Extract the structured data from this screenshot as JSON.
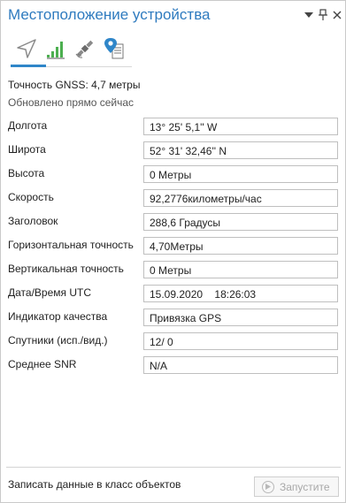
{
  "window": {
    "title": "Местоположение устройства",
    "menu_icon": "dropdown-arrow-icon",
    "pin_icon": "pin-icon",
    "close_icon": "close-icon"
  },
  "tabs": [
    {
      "name": "navigation-icon",
      "active": true
    },
    {
      "name": "signal-strength-icon",
      "active": false
    },
    {
      "name": "satellite-icon",
      "active": false
    },
    {
      "name": "location-list-icon",
      "active": false
    }
  ],
  "status": {
    "accuracy": "Точность GNSS: 4,7 метры",
    "updated": "Обновлено прямо сейчас"
  },
  "fields": [
    {
      "label": "Долгота",
      "value": "13° 25' 5,1'' W"
    },
    {
      "label": "Широта",
      "value": "52° 31' 32,46'' N"
    },
    {
      "label": "Высота",
      "value": "0 Метры"
    },
    {
      "label": "Скорость",
      "value": "92,2776километры/час"
    },
    {
      "label": "Заголовок",
      "value": "288,6 Градусы"
    },
    {
      "label": "Горизонтальная точность",
      "value": "4,70Метры"
    },
    {
      "label": "Вертикальная точность",
      "value": "0 Метры"
    },
    {
      "label": "Дата/Время UTC",
      "value": "15.09.2020    18:26:03"
    },
    {
      "label": "Индикатор качества",
      "value": "Привязка GPS"
    },
    {
      "label": "Спутники (исп./вид.)",
      "value": "12/ 0"
    },
    {
      "label": "Среднее SNR",
      "value": "N/A"
    }
  ],
  "footer": {
    "label": "Записать данные в класс объектов",
    "button_label": "Запустите"
  },
  "colors": {
    "title": "#2f7bbf",
    "accent": "#2f86c9",
    "disabled_text": "#a8a8a8"
  }
}
